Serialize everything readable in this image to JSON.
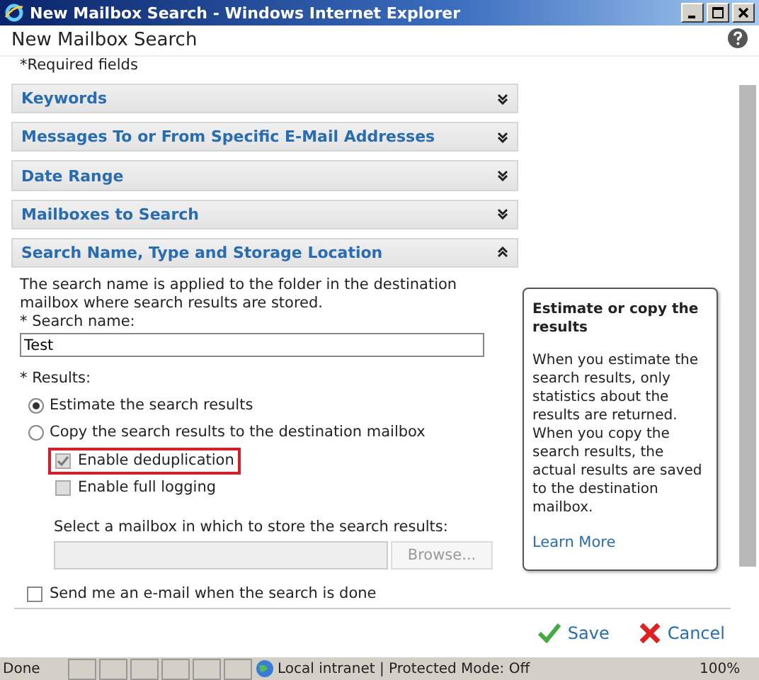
{
  "window": {
    "title": "New Mailbox Search - Windows Internet Explorer"
  },
  "page": {
    "title": "New Mailbox Search",
    "required_note": "*Required fields"
  },
  "sections": [
    {
      "label": "Keywords",
      "expanded": false
    },
    {
      "label": "Messages To or From Specific E-Mail Addresses",
      "expanded": false
    },
    {
      "label": "Date Range",
      "expanded": false
    },
    {
      "label": "Mailboxes to Search",
      "expanded": false
    },
    {
      "label": "Search Name, Type and Storage Location",
      "expanded": true
    }
  ],
  "form": {
    "intro": "The search name is applied to the folder in the destination mailbox where search results are stored.",
    "name_label": "* Search name:",
    "name_value": "Test",
    "results_label": "* Results:",
    "results": [
      {
        "label": "Estimate the search results",
        "selected": true
      },
      {
        "label": "Copy the search results to the destination mailbox",
        "selected": false
      }
    ],
    "options": [
      {
        "label": "Enable deduplication",
        "checked": true,
        "disabled": true,
        "highlighted": true
      },
      {
        "label": "Enable full logging",
        "checked": false,
        "disabled": true,
        "highlighted": false
      }
    ],
    "mailbox_label": "Select a mailbox in which to store the search results:",
    "browse": "Browse...",
    "notify": {
      "label": "Send me an e-mail when the search is done",
      "checked": false
    }
  },
  "tooltip": {
    "title": "Estimate or copy the results",
    "body": "When you estimate the search results, only statistics about the results are returned. When you copy the search results, the actual results are saved to the destination mailbox.",
    "link": "Learn More"
  },
  "buttons": [
    {
      "kind": "save",
      "label": "Save"
    },
    {
      "kind": "cancel",
      "label": "Cancel"
    }
  ],
  "status_bar": {
    "text": "Done",
    "zone": "Local intranet | Protected Mode: Off",
    "zoom": "100%"
  }
}
